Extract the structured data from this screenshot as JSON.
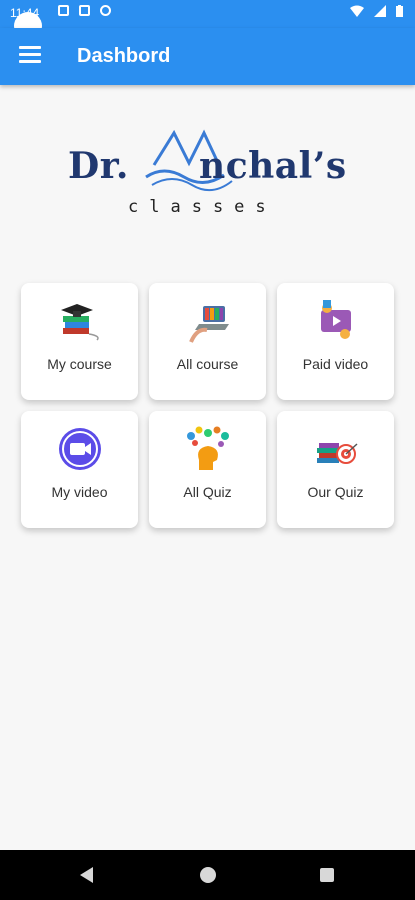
{
  "status_bar": {
    "time": "11:44"
  },
  "app_bar": {
    "title": "Dashbord"
  },
  "logo": {
    "main_before": "Dr.",
    "main_after": "nchal’s",
    "sub": "classes"
  },
  "tiles": [
    {
      "label": "My course",
      "icon": "books-graduation-cap-icon"
    },
    {
      "label": "All course",
      "icon": "online-learning-laptop-icon"
    },
    {
      "label": "Paid video",
      "icon": "video-coins-icon"
    },
    {
      "label": "My video",
      "icon": "video-camera-circle-icon"
    },
    {
      "label": "All Quiz",
      "icon": "head-ideas-icon"
    },
    {
      "label": "Our Quiz",
      "icon": "books-target-icon"
    }
  ],
  "colors": {
    "primary": "#2b8ff0",
    "logo_navy": "#20386f",
    "logo_blue": "#3a7bd5"
  }
}
